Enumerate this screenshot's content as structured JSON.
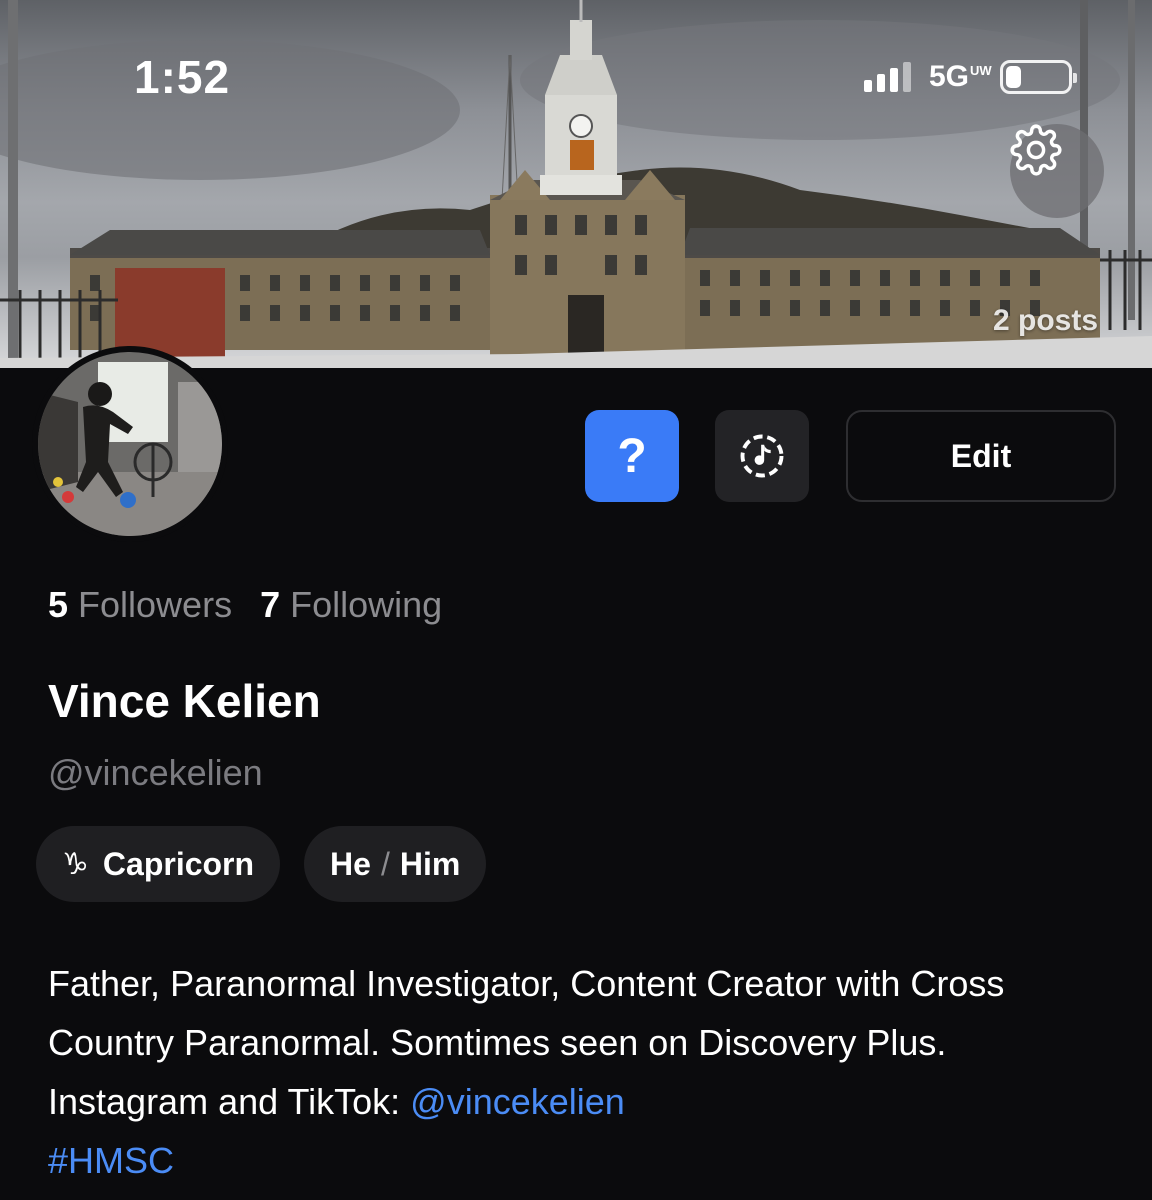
{
  "status_bar": {
    "time": "1:52",
    "network_label": "5G",
    "network_suffix": "UW",
    "battery_level": 0.25
  },
  "header": {
    "posts_count_label": "2 posts",
    "settings_icon": "gear-icon"
  },
  "actions": {
    "help_label": "?",
    "music_icon": "music-note-icon",
    "edit_label": "Edit"
  },
  "stats": {
    "followers_count": "5",
    "followers_label": "Followers",
    "following_count": "7",
    "following_label": "Following"
  },
  "profile": {
    "display_name": "Vince Kelien",
    "username": "@vincekelien"
  },
  "chips": {
    "zodiac_icon": "♑",
    "zodiac_label": "Capricorn",
    "pronoun_1": "He",
    "pronoun_sep": "/",
    "pronoun_2": "Him"
  },
  "bio": {
    "text": "Father, Paranormal Investigator, Content Creator with Cross Country Paranormal. Somtimes seen on Discovery Plus. Instagram and TikTok: ",
    "mention": "@vincekelien",
    "hashtag": "#HMSC"
  },
  "colors": {
    "background": "#0b0b0d",
    "accent_blue": "#3a7bf7",
    "link_blue": "#4b8cf5",
    "muted_text": "#8c8c90",
    "chip_bg": "#1f1f22"
  }
}
